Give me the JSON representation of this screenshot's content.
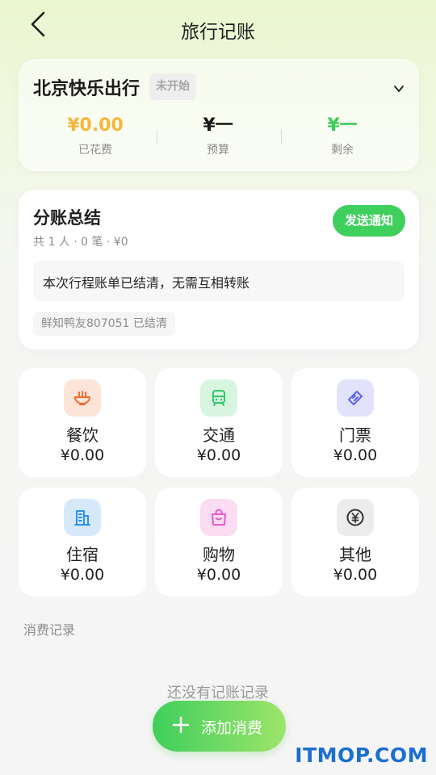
{
  "header": {
    "title": "旅行记账"
  },
  "trip": {
    "name": "北京快乐出行",
    "status": "未开始",
    "stats": [
      {
        "value": "¥0.00",
        "label": "已花费"
      },
      {
        "value": "¥一",
        "label": "预算"
      },
      {
        "value": "¥一",
        "label": "剩余"
      }
    ]
  },
  "split": {
    "title": "分账总结",
    "summary": "共 1 人 · 0 笔 · ¥0",
    "notify_label": "发送通知",
    "settled_message": "本次行程账单已结清，无需互相转账",
    "member_status": "鲜知鸭友807051 已结清"
  },
  "categories": [
    {
      "name": "餐饮",
      "amount": "¥0.00",
      "icon": "noodle-bowl-icon",
      "color": "#f26b2e"
    },
    {
      "name": "交通",
      "amount": "¥0.00",
      "icon": "train-icon",
      "color": "#2ec76a"
    },
    {
      "name": "门票",
      "amount": "¥0.00",
      "icon": "ticket-icon",
      "color": "#5b63f0"
    },
    {
      "name": "住宿",
      "amount": "¥0.00",
      "icon": "building-icon",
      "color": "#2c8ff0"
    },
    {
      "name": "购物",
      "amount": "¥0.00",
      "icon": "shopping-bag-icon",
      "color": "#e65ac8"
    },
    {
      "name": "其他",
      "amount": "¥0.00",
      "icon": "yuan-coin-icon",
      "color": "#333333"
    }
  ],
  "records": {
    "label": "消费记录",
    "empty": "还没有记账记录"
  },
  "add_button": {
    "label": "添加消费"
  },
  "watermark": "ITMOP.COM"
}
